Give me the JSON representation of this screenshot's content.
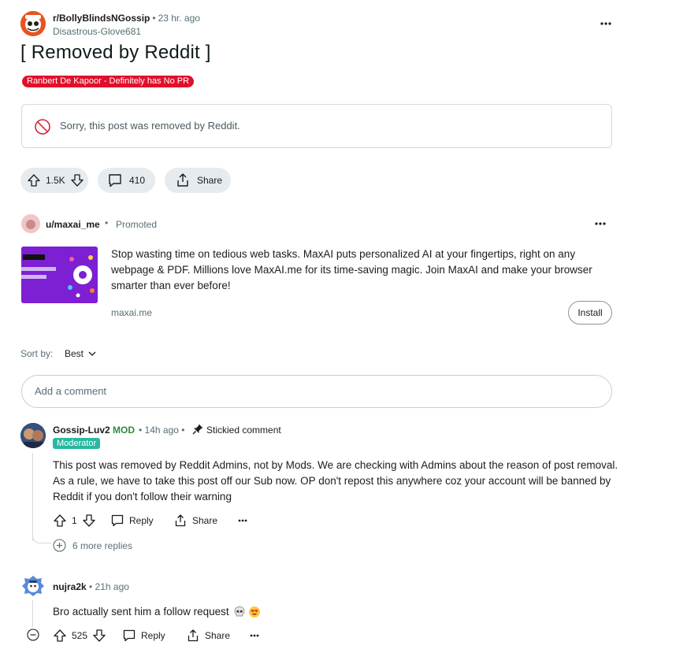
{
  "post": {
    "subreddit": "r/BollyBlindsNGossip",
    "separator": "•",
    "time": "23 hr. ago",
    "author": "Disastrous-Glove681",
    "title": "[ Removed by Reddit ]",
    "flair": "Ranbert De Kapoor - Definitely has No PR",
    "removed_notice": "Sorry, this post was removed by Reddit.",
    "votes": "1.5K",
    "comments": "410",
    "share_label": "Share"
  },
  "promoted": {
    "user": "u/maxai_me",
    "separator": "•",
    "label": "Promoted",
    "text": "Stop wasting time on tedious web tasks. MaxAI puts personalized AI at your fingertips, right on any webpage & PDF. Millions love MaxAI.me for its time-saving magic. Join MaxAI and make your browser smarter than ever before!",
    "domain": "maxai.me",
    "cta": "Install"
  },
  "sort": {
    "label": "Sort by:",
    "value": "Best"
  },
  "add_comment_placeholder": "Add a comment",
  "comments": [
    {
      "user": "Gossip-Luv2",
      "mod_tag": "MOD",
      "meta": "• 14h ago •",
      "sticky": "Stickied comment",
      "badge": "Moderator",
      "body": "This post was removed by Reddit Admins, not by Mods. We are checking with Admins about the reason of post removal. As a rule, we have to take this post off our Sub now. OP don't repost this anywhere coz your account will be banned by Reddit if you don't follow their warning",
      "votes": "1",
      "reply": "Reply",
      "share": "Share",
      "more_replies": "6 more replies"
    },
    {
      "user": "nujra2k",
      "meta": "• 21h ago",
      "body": "Bro actually sent him a follow request",
      "votes": "525",
      "reply": "Reply",
      "share": "Share"
    }
  ],
  "colors": {
    "flair_bg": "#e0102b",
    "mod_green": "#2e8b3f",
    "moderator_badge": "#28b9a0",
    "pill_bg": "#e5ebee",
    "ad_thumb": "#7d1fd2",
    "subreddit_icon": "#e8531e"
  },
  "icons": [
    "subreddit-icon",
    "more-icon",
    "no-entry-icon",
    "upvote-icon",
    "downvote-icon",
    "comment-icon",
    "share-icon",
    "chevron-down-icon",
    "pin-icon",
    "plus-circle-icon",
    "minus-circle-icon",
    "skull-emoji",
    "heart-eyes-emoji"
  ]
}
